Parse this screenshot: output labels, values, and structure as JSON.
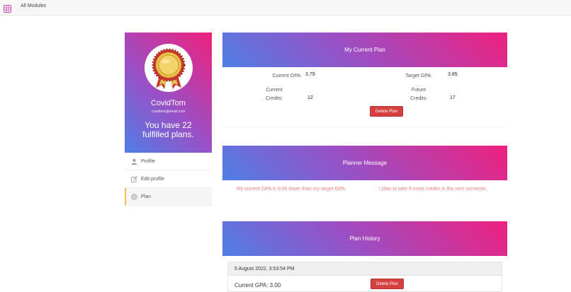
{
  "topbar": {
    "nav_label": "All Modules",
    "logo_icon": "grid-logo-icon"
  },
  "profile": {
    "username": "CovidTom",
    "email": "covidtom@email.com",
    "fulfilled_text": "You have 22 fulfilled plans.",
    "avatar_icon": "award-badge-icon"
  },
  "side_menu": {
    "items": [
      {
        "label": "Profile",
        "icon": "user-icon"
      },
      {
        "label": "Edit profile",
        "icon": "edit-icon"
      },
      {
        "label": "Plan",
        "icon": "target-icon"
      }
    ],
    "active_index": 2
  },
  "current_plan": {
    "title": "My Current Plan",
    "current_gpa_label": "Current GPA:",
    "current_gpa": "3.79",
    "target_gpa_label": "Target GPA:",
    "target_gpa": "3.85",
    "current_credits_label": "Current Credits:",
    "current_credits": "12",
    "future_credits_label": "Future Credits:",
    "future_credits": "17",
    "delete_label": "Delete Plan"
  },
  "planner_message": {
    "title": "Planner Message",
    "left": "My current GPA is 0.06 lower than my target GPA.",
    "right": "I plan to take 5 more credits in the next semester."
  },
  "plan_history": {
    "title": "Plan History",
    "entries": [
      {
        "date": "5 August 2022, 3:53:54 PM",
        "gpa_text": "Current GPA: 3.00",
        "delete_label": "Delete Plan"
      }
    ]
  },
  "colors": {
    "gradient_start": "#4f7fe6",
    "gradient_mid": "#9b4fc4",
    "gradient_end": "#f0207e",
    "delete": "#d64040",
    "message": "#f08080",
    "active_marker": "#f2c14e"
  }
}
